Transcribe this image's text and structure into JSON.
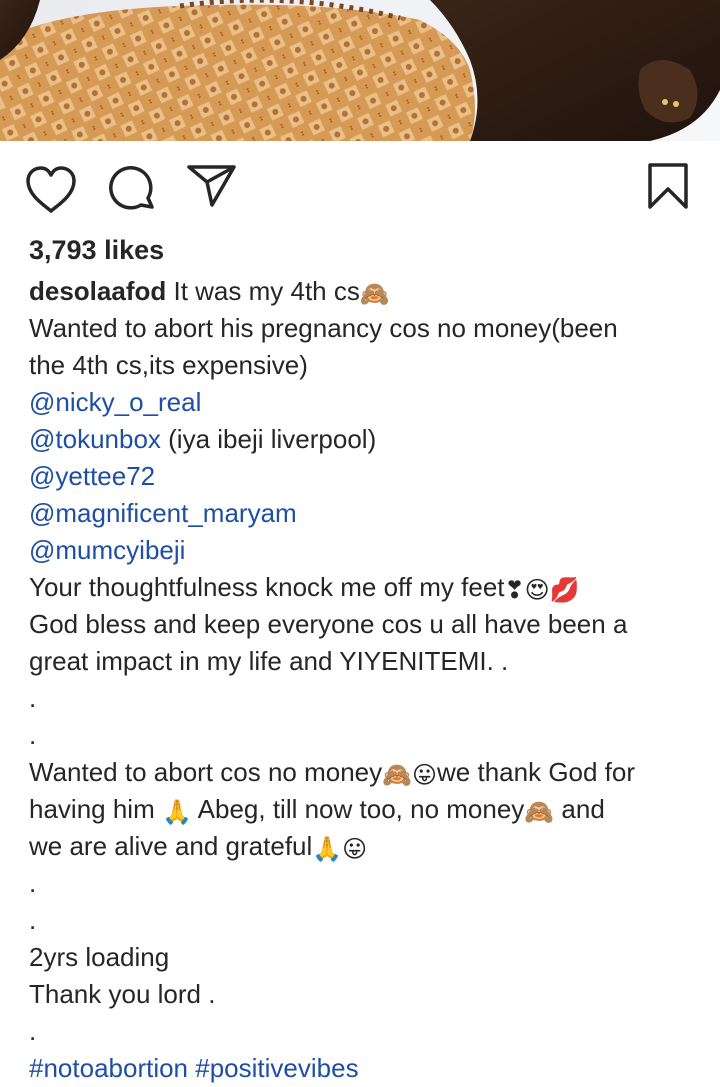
{
  "post": {
    "likes": "3,793 likes",
    "username": "desolaafod"
  },
  "actions": {
    "like_icon": "heart-icon",
    "comment_icon": "comment-bubble-icon",
    "share_icon": "paper-plane-icon",
    "save_icon": "bookmark-icon"
  },
  "caption": {
    "l1_text": " It was my 4th cs",
    "l1_emoji": "🙈",
    "l2": "Wanted to abort his pregnancy cos no money(been",
    "l3": "the 4th cs,its expensive)",
    "mention1": "@nicky_o_real",
    "mention2": "@tokunbox",
    "mention2_suffix": " (iya ibeji liverpool)",
    "mention3": "@yettee72",
    "mention4": "@magnificent_maryam",
    "mention5": "@mumcyibeji",
    "l9_text": "Your thoughtfulness knock me off my feet",
    "l9_emoji": "❣😍💋",
    "l10": "God bless and keep everyone cos u all have been a",
    "l11": "great impact in my life and YIYENITEMI. .",
    "dot1": ".",
    "dot2": ".",
    "l14_a": "Wanted to abort cos no money",
    "l14_emoji": "🙈😛",
    "l14_b": "we thank God for",
    "l15_a": "having him ",
    "l15_emoji1": "🙏",
    "l15_b": " Abeg, till now too, no money",
    "l15_emoji2": "🙈",
    "l15_c": " and",
    "l16_a": "we are alive and grateful",
    "l16_emoji": "🙏😛",
    "dot3": ".",
    "dot4": ".",
    "l19": "2yrs loading",
    "l20": "Thank you lord .",
    "dot5": ".",
    "hashtag1": "#notoabortion",
    "hashtag2": "#positivevibes"
  },
  "colors": {
    "link": "#1e4fa3",
    "text": "#262626"
  }
}
